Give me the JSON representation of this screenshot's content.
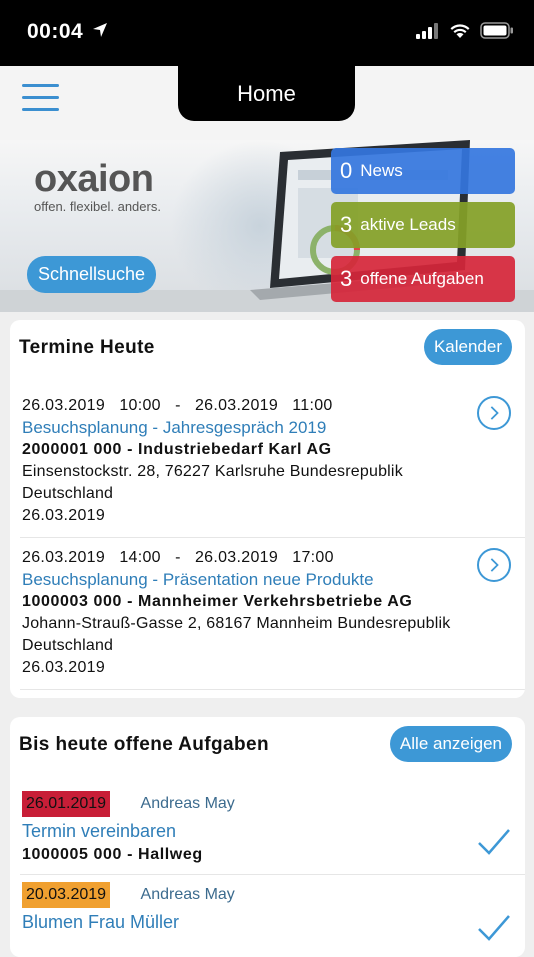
{
  "status": {
    "time": "00:04"
  },
  "header": {
    "title": "Home"
  },
  "banner": {
    "brand": "oxaion",
    "slogan": "offen. flexibel. anders.",
    "quick_search": "Schnellsuche",
    "stats": [
      {
        "num": "0",
        "label": "News"
      },
      {
        "num": "3",
        "label": "aktive Leads"
      },
      {
        "num": "3",
        "label": "offene Aufgaben"
      }
    ]
  },
  "termine": {
    "title": "Termine Heute",
    "button": "Kalender",
    "items": [
      {
        "start": "26.03.2019   10:00",
        "sep": "   -   ",
        "end": "26.03.2019   11:00",
        "title": "Besuchsplanung - Jahresgespräch 2019",
        "company": "2000001 000 - Industriebedarf Karl AG",
        "addr1": "Einsenstockstr. 28, 76227 Karlsruhe Bundesrepublik",
        "addr2": "Deutschland",
        "date": "26.03.2019"
      },
      {
        "start": "26.03.2019   14:00",
        "sep": "   -   ",
        "end": "26.03.2019   17:00",
        "title": "Besuchsplanung - Präsentation neue Produkte",
        "company": "1000003 000 - Mannheimer Verkehrsbetriebe AG",
        "addr1": "Johann-Strauß-Gasse 2, 68167 Mannheim Bundesrepublik",
        "addr2": "Deutschland",
        "date": "26.03.2019"
      }
    ]
  },
  "aufgaben": {
    "title": "Bis heute offene Aufgaben",
    "button": "Alle anzeigen",
    "items": [
      {
        "date": "26.01.2019",
        "owner": "Andreas May",
        "title": "Termin vereinbaren",
        "sub": "1000005 000 - Hallweg"
      },
      {
        "date": "20.03.2019",
        "owner": "Andreas May",
        "title": "Blumen Frau Müller",
        "sub": ""
      }
    ]
  },
  "colors": {
    "accent": "#3d98d6",
    "news": "#3476de",
    "leads": "#84a028",
    "tasks": "#d6263a"
  }
}
